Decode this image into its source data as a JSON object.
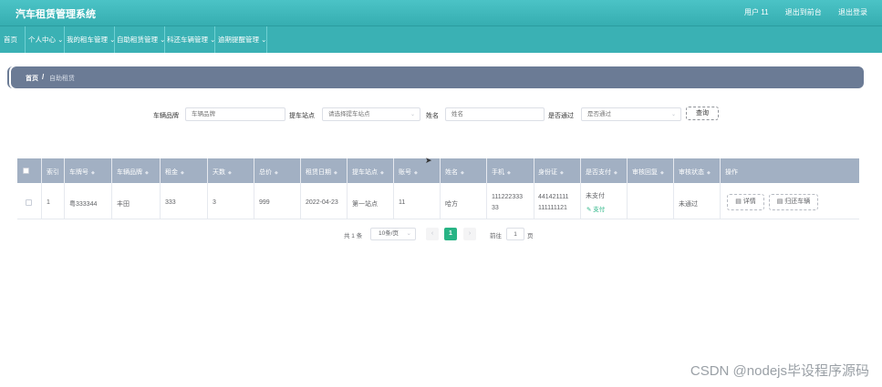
{
  "app": {
    "title": "汽车租赁管理系统"
  },
  "topbar": {
    "user": "用户 11",
    "backend_link": "退出到前台",
    "logout": "退出登录"
  },
  "nav": {
    "items": [
      {
        "label": "首页"
      },
      {
        "label": "个人中心"
      },
      {
        "label": "我的租车管理"
      },
      {
        "label": "自助租赁管理"
      },
      {
        "label": "科还车辆管理"
      },
      {
        "label": "逾期提醒管理"
      }
    ]
  },
  "breadcrumb": {
    "home": "首页",
    "separator": "/",
    "current": "自助租赁"
  },
  "filters": {
    "brand": {
      "label": "车辆品牌",
      "placeholder": "车辆品牌"
    },
    "station": {
      "label": "提车站点",
      "placeholder": "请选择提车站点"
    },
    "name": {
      "label": "姓名",
      "placeholder": "姓名"
    },
    "approved": {
      "label": "是否通过",
      "placeholder": "是否通过"
    },
    "search_button": "查询"
  },
  "table": {
    "headers": [
      "索引",
      "车牌号",
      "车辆品牌",
      "租金",
      "天数",
      "总价",
      "租赁日期",
      "提车站点",
      "账号",
      "姓名",
      "手机",
      "身份证",
      "是否支付",
      "审核回复",
      "审核状态",
      "操作"
    ],
    "rows": [
      {
        "index": "1",
        "plate": "粤333344",
        "brand": "丰田",
        "rent": "333",
        "days": "3",
        "total": "999",
        "date": "2022-04-23",
        "station": "第一站点",
        "account": "11",
        "name": "哈方",
        "phone_line1": "111222333",
        "phone_line2": "33",
        "id_line1": "441421111",
        "id_line2": "111111121",
        "paid_status": "未支付",
        "pay_link": "支付",
        "review_reply": "",
        "review_status": "未通过",
        "detail_button": "详情",
        "return_button": "归还车辆"
      }
    ]
  },
  "pagination": {
    "total": "共 1 条",
    "page_size": "10条/页",
    "current_page": "1",
    "goto_label": "前往",
    "goto_value": "1",
    "page_suffix": "页"
  },
  "watermark": "CSDN @nodejs毕设程序源码"
}
